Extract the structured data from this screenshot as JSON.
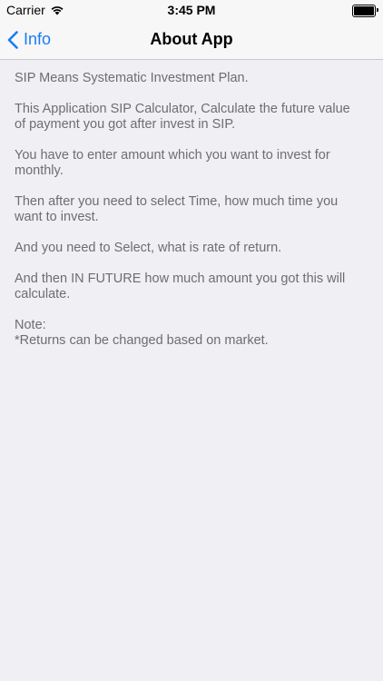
{
  "status_bar": {
    "carrier": "Carrier",
    "time": "3:45 PM",
    "wifi_icon": "wifi-icon",
    "battery_icon": "battery-icon"
  },
  "nav": {
    "back_label": "Info",
    "back_icon": "chevron-left-icon",
    "title": "About App",
    "accent_color": "#1a7cf5"
  },
  "content": {
    "paragraphs": [
      "SIP Means Systematic Investment Plan.",
      "This Application SIP Calculator, Calculate the future value of payment you got after invest in SIP.",
      "You have to enter amount which you want to invest for monthly.",
      "Then after you need to select Time, how much time you want to invest.",
      "And you need to Select, what is rate of return.",
      "And then IN FUTURE how much amount you got this will calculate."
    ],
    "note_label": "Note:",
    "note_text": "*Returns can be changed based on market."
  }
}
